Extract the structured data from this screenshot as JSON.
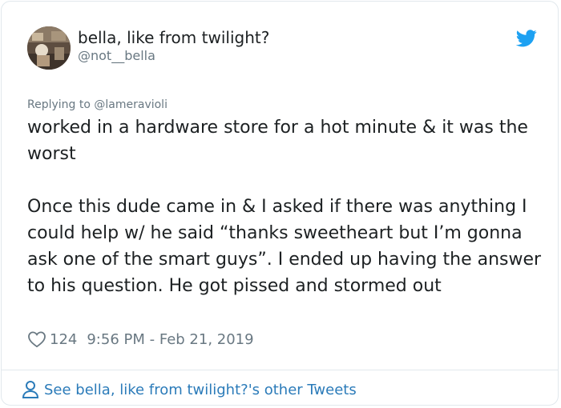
{
  "header": {
    "display_name": "bella, like from twilight?",
    "handle": "@not__bella"
  },
  "reply": {
    "prefix": "Replying to ",
    "mention": "@lameravioli"
  },
  "tweet": {
    "paragraphs": [
      "worked in a hardware store for a hot minute & it was the worst",
      "Once this dude came in & I asked if there was anything I could help w/ he said “thanks sweetheart but I’m gonna ask one of the smart guys”. I ended up having the answer to his question. He got pissed and stormed out"
    ]
  },
  "meta": {
    "like_count": "124",
    "timestamp": "9:56 PM - Feb 21, 2019"
  },
  "footer": {
    "link_label": "See bella, like from twilight?'s other Tweets"
  },
  "colors": {
    "accent": "#1da1f2",
    "link": "#2b7bb9",
    "muted": "#697882",
    "text": "#1c2022",
    "border": "#e1e8ed"
  },
  "icons": {
    "brand": "twitter-bird-icon",
    "like": "heart-icon",
    "profile": "person-icon"
  }
}
